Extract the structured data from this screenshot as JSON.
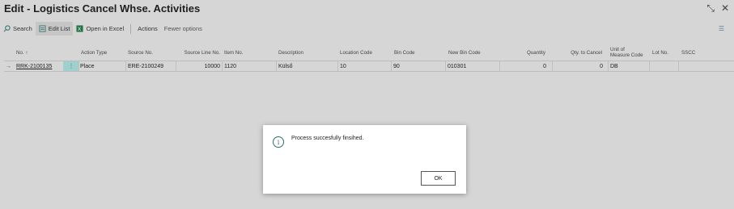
{
  "window": {
    "title": "Edit - Logistics Cancel Whse. Activities",
    "collapse_glyph": "⤡",
    "close_glyph": "✕"
  },
  "toolbar": {
    "search": "Search",
    "edit_list": "Edit List",
    "open_excel": "Open in Excel",
    "actions": "Actions",
    "fewer_options": "Fewer options",
    "list_glyph": "☰"
  },
  "columns": {
    "no": "No. ↑",
    "action_type": "Action Type",
    "source_no": "Source No.",
    "source_line_no": "Source Line No.",
    "item_no": "Item No.",
    "description": "Description",
    "location_code": "Location Code",
    "bin_code": "Bin Code",
    "new_bin_code": "New Bin Code",
    "quantity": "Quantity",
    "qty_to_cancel": "Qty. to Cancel",
    "uom_line1": "Unit of",
    "uom_line2": "Measure Code",
    "lot_no": "Lot No.",
    "sscc": "SSCC"
  },
  "row": {
    "arrow": "→",
    "no": "RRK-2100135",
    "menu": "⋮",
    "action_type": "Place",
    "source_no": "ERE-2100249",
    "source_line_no": "10000",
    "item_no": "1120",
    "description": "Külső",
    "location_code": "10",
    "bin_code": "90",
    "new_bin_code": "010301",
    "quantity": "0",
    "qty_to_cancel": "0",
    "uom": "DB",
    "lot_no": "",
    "sscc": ""
  },
  "dialog": {
    "info_glyph": "i",
    "message": "Process succesfully finsihed.",
    "ok": "OK"
  }
}
